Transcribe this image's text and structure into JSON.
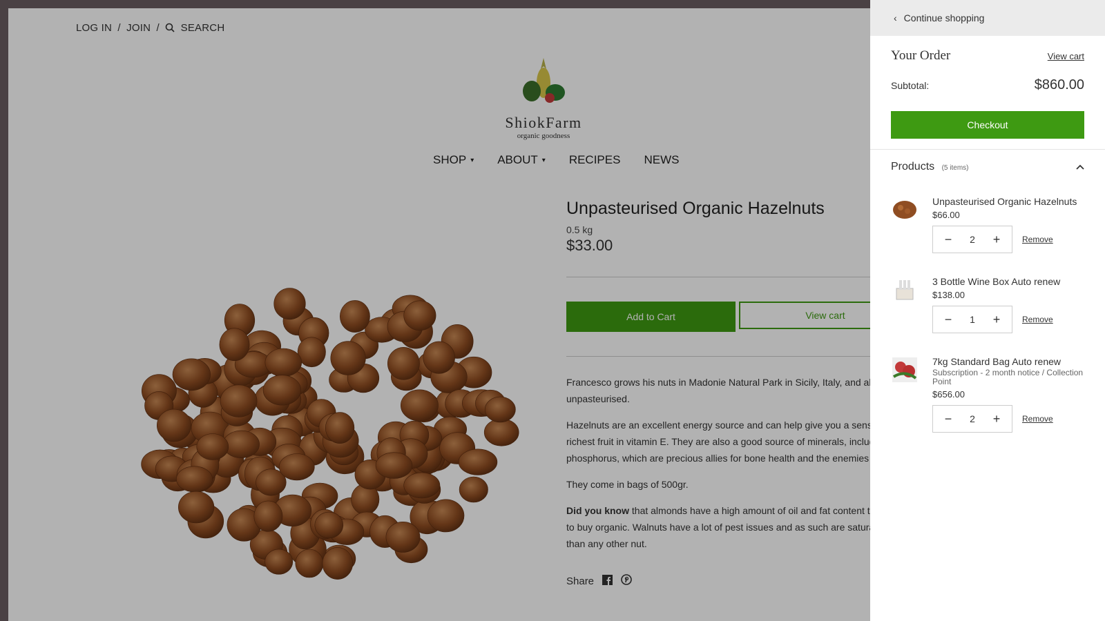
{
  "topbar": {
    "login": "LOG IN",
    "sep1": "/",
    "join": "JOIN",
    "sep2": "/",
    "search": "SEARCH"
  },
  "logo": {
    "name": "ShiokFarm",
    "tagline": "organic goodness"
  },
  "nav": {
    "shop": "SHOP",
    "about": "ABOUT",
    "recipes": "RECIPES",
    "news": "NEWS"
  },
  "product": {
    "title": "Unpasteurised Organic Hazelnuts",
    "weight": "0.5 kg",
    "price": "$33.00",
    "add_to_cart": "Add to Cart",
    "view_cart": "View cart",
    "desc": [
      "Francesco grows his nuts in Madonie Natural Park in Sicily, Italy, and all his",
      "unpasteurised.",
      "Hazelnuts are an excellent energy source and can help give you a sense of",
      "richest fruit in vitamin E. They are also a good source of minerals, includin",
      "phosphorus, which are precious allies for bone health and the enemies of",
      "They come in bags of 500gr.",
      "Did you know",
      "that almonds have a high amount of oil and fat content tha",
      "to buy organic. Walnuts have a lot of pest issues and as such are saturated",
      "than any other nut."
    ],
    "share": "Share"
  },
  "drawer": {
    "continue": "Continue shopping",
    "order_title": "Your Order",
    "view_cart": "View cart",
    "subtotal_label": "Subtotal:",
    "subtotal": "$860.00",
    "checkout": "Checkout",
    "products_title": "Products",
    "products_count": "(5 items)",
    "items": [
      {
        "name": "Unpasteurised Organic Hazelnuts",
        "sub": "",
        "price": "$66.00",
        "qty": "2",
        "remove": "Remove"
      },
      {
        "name": "3 Bottle Wine Box Auto renew",
        "sub": "",
        "price": "$138.00",
        "qty": "1",
        "remove": "Remove"
      },
      {
        "name": "7kg Standard Bag Auto renew",
        "sub": "Subscription - 2 month notice / Collection Point",
        "price": "$656.00",
        "qty": "2",
        "remove": "Remove"
      }
    ]
  },
  "colors": {
    "accent": "#3e9a12",
    "overlay": "rgba(0,0,0,0.3)"
  }
}
